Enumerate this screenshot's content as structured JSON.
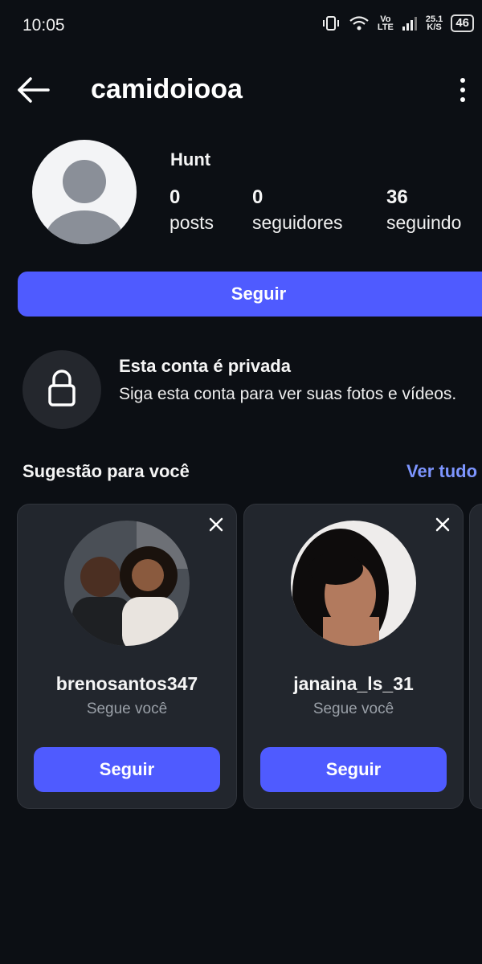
{
  "status_bar": {
    "time": "10:05",
    "network_top": "Vo",
    "network_bottom": "LTE",
    "speed_value": "25.1",
    "speed_unit": "K/S",
    "battery": "46"
  },
  "header": {
    "username": "camidoiooa"
  },
  "profile": {
    "display_name": "Hunt",
    "stats": [
      {
        "value": "0",
        "label": "posts"
      },
      {
        "value": "0",
        "label": "seguidores"
      },
      {
        "value": "36",
        "label": "seguindo"
      }
    ],
    "follow_label": "Seguir"
  },
  "private": {
    "title": "Esta conta é privada",
    "description": "Siga esta conta para ver suas fotos e vídeos."
  },
  "suggestions": {
    "title": "Sugestão para você",
    "see_all": "Ver tudo",
    "cards": [
      {
        "username": "brenosantos347",
        "subtitle": "Segue você",
        "button": "Seguir"
      },
      {
        "username": "janaina_ls_31",
        "subtitle": "Segue você",
        "button": "Seguir"
      }
    ]
  },
  "colors": {
    "background": "#0c0f14",
    "accent": "#4f5bff",
    "link": "#7d95ff",
    "card": "#22262d"
  }
}
